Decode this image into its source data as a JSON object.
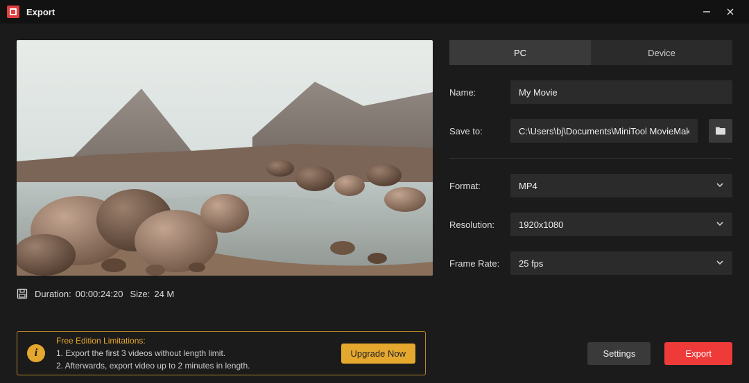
{
  "titlebar": {
    "title": "Export"
  },
  "tabs": {
    "pc": "PC",
    "device": "Device",
    "active": "pc"
  },
  "fields": {
    "name": {
      "label": "Name:",
      "value": "My Movie"
    },
    "saveTo": {
      "label": "Save to:",
      "value": "C:\\Users\\bj\\Documents\\MiniTool MovieMaker\\outp"
    },
    "format": {
      "label": "Format:",
      "value": "MP4"
    },
    "resolution": {
      "label": "Resolution:",
      "value": "1920x1080"
    },
    "frameRate": {
      "label": "Frame Rate:",
      "value": "25 fps"
    }
  },
  "info": {
    "durationLabel": "Duration:",
    "durationValue": "00:00:24:20",
    "sizeLabel": "Size:",
    "sizeValue": "24 M"
  },
  "limitations": {
    "header": "Free Edition Limitations:",
    "line1": "1. Export the first 3 videos without length limit.",
    "line2": "2. Afterwards, export video up to 2 minutes in length.",
    "upgrade": "Upgrade Now"
  },
  "footer": {
    "settings": "Settings",
    "export": "Export"
  }
}
